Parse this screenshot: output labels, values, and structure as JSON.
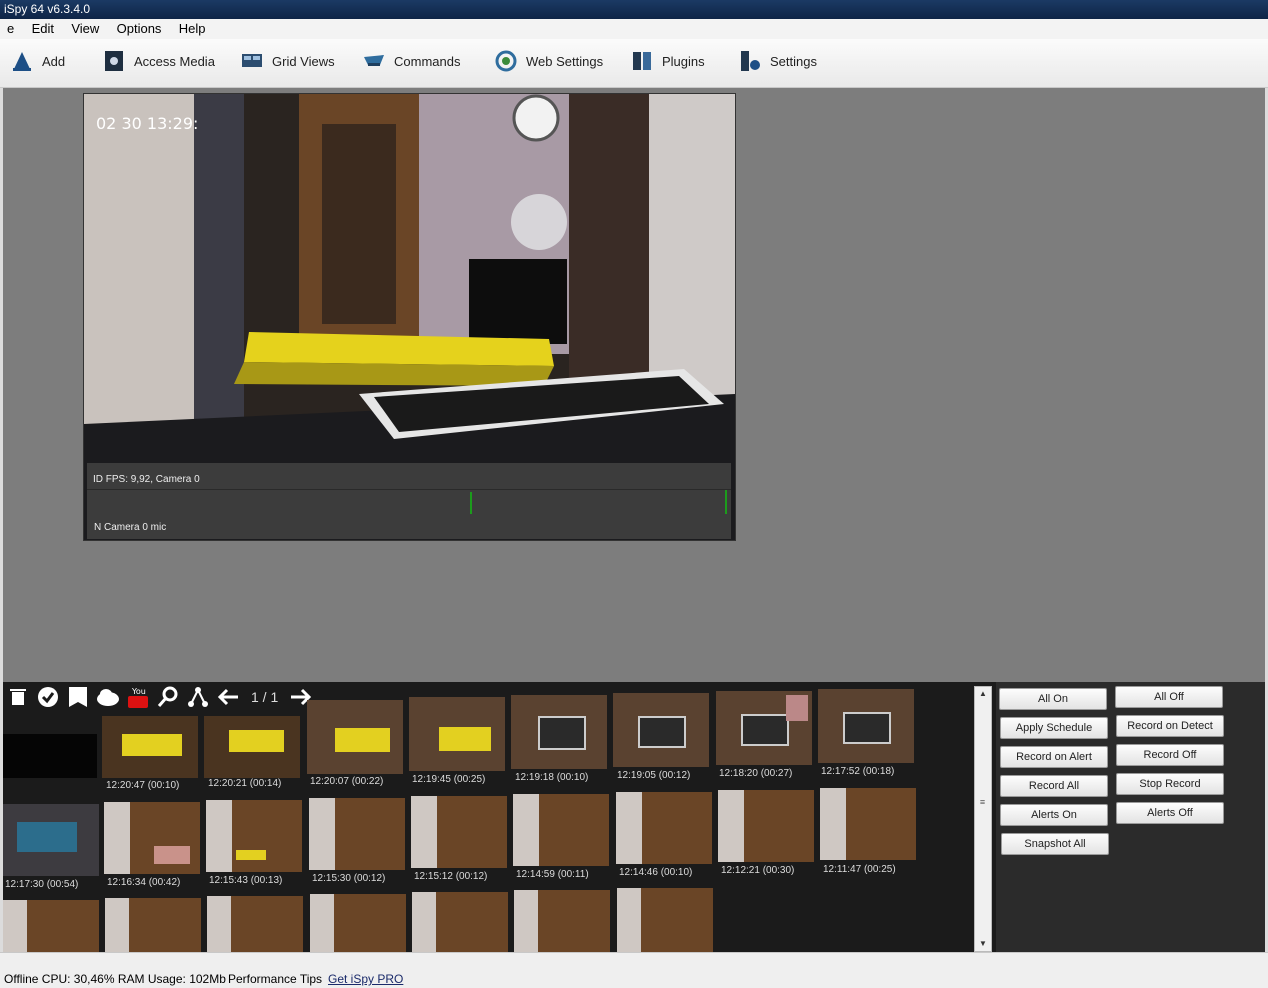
{
  "window": {
    "title": "iSpy 64 v6.3.4.0"
  },
  "menu": [
    "e",
    "Edit",
    "View",
    "Options",
    "Help"
  ],
  "toolbar": {
    "add": "Add",
    "access_media": "Access Media",
    "grid_views": "Grid Views",
    "commands": "Commands",
    "web_settings": "Web Settings",
    "plugins": "Plugins",
    "settings": "Settings"
  },
  "camera": {
    "timestamp": "02 30  13:29:",
    "info": "ID  FPS: 9,92, Camera 0",
    "mic": "N  Camera 0 mic"
  },
  "gallery": {
    "pager": "1 / 1",
    "thumbs_row1": [
      "12:20:47 (00:10)",
      "12:20:21 (00:14)",
      "12:20:07 (00:22)",
      "12:19:45 (00:25)",
      "12:19:18 (00:10)",
      "12:19:05 (00:12)",
      "12:18:20 (00:27)",
      "12:17:52 (00:18)"
    ],
    "thumbs_row2": [
      "12:17:30 (00:54)",
      "12:16:34 (00:42)",
      "12:15:43 (00:13)",
      "12:15:30 (00:12)",
      "12:15:12 (00:12)",
      "12:14:59 (00:11)",
      "12:14:46 (00:10)",
      "12:12:21 (00:30)",
      "12:11:47 (00:25)"
    ]
  },
  "controls": {
    "all_on": "All On",
    "all_off": "All Off",
    "apply_schedule": "Apply Schedule",
    "record_on_detect": "Record on Detect",
    "record_on_alert": "Record on Alert",
    "record_off": "Record Off",
    "record_all": "Record All",
    "stop_record": "Stop Record",
    "alerts_on": "Alerts On",
    "alerts_off": "Alerts Off",
    "snapshot_all": "Snapshot All"
  },
  "status": {
    "text": "Offline   CPU: 30,46% RAM Usage: 102Mb",
    "perf": "Performance Tips",
    "getpro": "Get iSpy PRO"
  }
}
